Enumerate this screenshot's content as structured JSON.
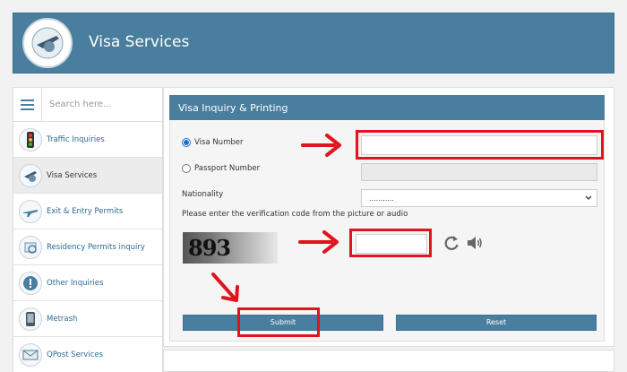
{
  "header": {
    "title": "Visa Services",
    "logo_icon": "visa-logo-icon"
  },
  "sidebar": {
    "search_placeholder": "Search here...",
    "items": [
      {
        "label": "Traffic Inquiries",
        "icon": "traffic-light-icon"
      },
      {
        "label": "Visa Services",
        "icon": "visa-icon"
      },
      {
        "label": "Exit & Entry Permits",
        "icon": "airplane-icon"
      },
      {
        "label": "Residency Permits inquiry",
        "icon": "residency-icon"
      },
      {
        "label": "Other Inquiries",
        "icon": "info-icon"
      },
      {
        "label": "Metrash",
        "icon": "phone-icon"
      },
      {
        "label": "QPost Services",
        "icon": "post-icon"
      }
    ]
  },
  "form": {
    "title": "Visa Inquiry & Printing",
    "visa_number_label": "Visa Number",
    "visa_number_value": "",
    "passport_number_label": "Passport Number",
    "passport_number_value": "",
    "nationality_label": "Nationality",
    "nationality_value": "...........",
    "captcha_hint": "Please enter the verification code from the picture or audio",
    "captcha_text": "893",
    "captcha_value": "",
    "submit_label": "Submit",
    "reset_label": "Reset"
  },
  "colors": {
    "accent": "#4a7e9f",
    "annotation": "#e0141c"
  }
}
